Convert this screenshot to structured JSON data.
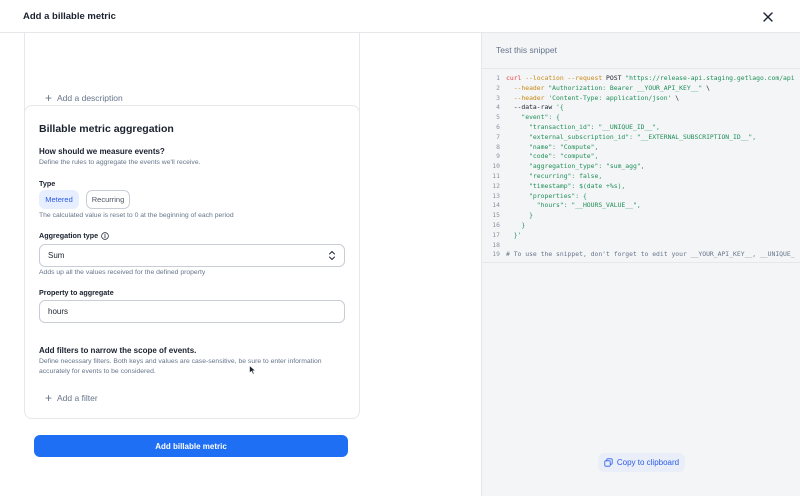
{
  "header": {
    "title": "Add a billable metric",
    "close_icon": "close-icon"
  },
  "form": {
    "add_description_label": "Add a description",
    "aggregation_card": {
      "heading": "Billable metric aggregation",
      "measure_heading": "How should we measure events?",
      "measure_help": "Define the rules to aggregate the events we'll receive.",
      "type_label": "Type",
      "type_options": [
        "Metered",
        "Recurring"
      ],
      "type_selected": "Metered",
      "type_help": "The calculated value is reset to 0 at the beginning of each period",
      "aggregation_type_label": "Aggregation type",
      "aggregation_type_value": "Sum",
      "aggregation_type_help": "Adds up all the values received for the defined property",
      "property_label": "Property to aggregate",
      "property_value": "hours",
      "filters_heading": "Add filters to narrow the scope of events.",
      "filters_help_1": "Define necessary filters. Both keys and values are case-sensitive, be sure to enter information",
      "filters_help_2": "accurately for events to be considered.",
      "add_filter_label": "Add a filter"
    },
    "submit_label": "Add billable metric"
  },
  "snippet": {
    "title": "Test this snippet",
    "copy_label": "Copy to clipboard",
    "lines": [
      {
        "n": "1",
        "parts": [
          {
            "c": "c-cmd",
            "t": "curl"
          },
          {
            "c": "c-flag",
            "t": " --location --request"
          },
          {
            "c": "c-plain",
            "t": " POST "
          },
          {
            "c": "c-str",
            "t": "\"https://release-api.staging.getlago.com/api"
          }
        ]
      },
      {
        "n": "2",
        "parts": [
          {
            "c": "c-flag",
            "t": "  --header"
          },
          {
            "c": "c-str",
            "t": " \"Authorization: Bearer __YOUR_API_KEY__\""
          },
          {
            "c": "c-plain",
            "t": " \\"
          }
        ]
      },
      {
        "n": "3",
        "parts": [
          {
            "c": "c-flag",
            "t": "  --header"
          },
          {
            "c": "c-str",
            "t": " 'Content-Type: application/json'"
          },
          {
            "c": "c-plain",
            "t": " \\"
          }
        ]
      },
      {
        "n": "4",
        "parts": [
          {
            "c": "c-plain",
            "t": "  --data-raw "
          },
          {
            "c": "c-str",
            "t": "'{"
          }
        ]
      },
      {
        "n": "5",
        "parts": [
          {
            "c": "c-str",
            "t": "    \"event\": {"
          }
        ]
      },
      {
        "n": "6",
        "parts": [
          {
            "c": "c-str",
            "t": "      \"transaction_id\": \"__UNIQUE_ID__\","
          }
        ]
      },
      {
        "n": "7",
        "parts": [
          {
            "c": "c-str",
            "t": "      \"external_subscription_id\": \"__EXTERNAL_SUBSCRIPTION_ID__\","
          }
        ]
      },
      {
        "n": "8",
        "parts": [
          {
            "c": "c-str",
            "t": "      \"name\": \"Compute\","
          }
        ]
      },
      {
        "n": "9",
        "parts": [
          {
            "c": "c-str",
            "t": "      \"code\": \"compute\","
          }
        ]
      },
      {
        "n": "10",
        "parts": [
          {
            "c": "c-str",
            "t": "      \"aggregation_type\": \"sum_agg\","
          }
        ]
      },
      {
        "n": "11",
        "parts": [
          {
            "c": "c-str",
            "t": "      \"recurring\": false,"
          }
        ]
      },
      {
        "n": "12",
        "parts": [
          {
            "c": "c-str",
            "t": "      \"timestamp\": $(date +%s),"
          }
        ]
      },
      {
        "n": "13",
        "parts": [
          {
            "c": "c-str",
            "t": "      \"properties\": {"
          }
        ]
      },
      {
        "n": "14",
        "parts": [
          {
            "c": "c-str",
            "t": "        \"hours\": \"__HOURS_VALUE__\","
          }
        ]
      },
      {
        "n": "15",
        "parts": [
          {
            "c": "c-str",
            "t": "      }"
          }
        ]
      },
      {
        "n": "16",
        "parts": [
          {
            "c": "c-str",
            "t": "    }"
          }
        ]
      },
      {
        "n": "17",
        "parts": [
          {
            "c": "c-str",
            "t": "  }'"
          }
        ]
      },
      {
        "n": "18",
        "parts": []
      },
      {
        "n": "19",
        "parts": [
          {
            "c": "c-com",
            "t": "# To use the snippet, don't forget to edit your __YOUR_API_KEY__, __UNIQUE_"
          }
        ]
      }
    ]
  }
}
